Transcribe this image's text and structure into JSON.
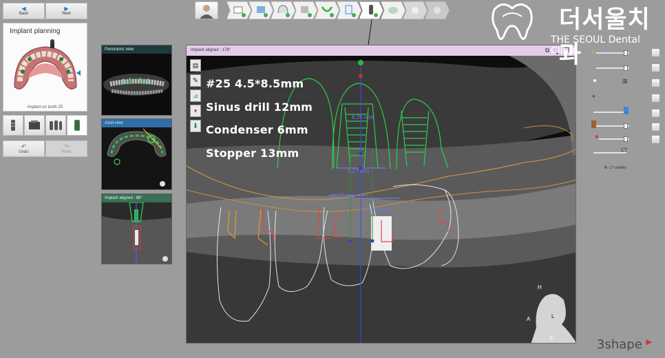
{
  "nav": {
    "back_label": "Back",
    "next_label": "Next"
  },
  "planning": {
    "title": "Implant planning",
    "subtitle": "Implant on tooth 25"
  },
  "undo": {
    "undo_label": "Undo",
    "redo_label": "Redo"
  },
  "views": {
    "panoramic_title": "Panoramic view",
    "axial_title": "Axial view",
    "implant_aligned_small_title": "Implant aligned : 88°"
  },
  "main_view": {
    "title": "Implant aligned : 178°",
    "overlay_lines": [
      "#25 4.5*8.5mm",
      "Sinus drill 12mm",
      "Condenser 6mm",
      "Stopper 13mm"
    ],
    "measurements": [
      "8.25 mm",
      "6.27 mm",
      "12.77 mm",
      "11.30 mm"
    ],
    "head_labels": {
      "h": "H",
      "a": "A",
      "l": "L",
      "f": "F"
    }
  },
  "right_panel": {
    "ct_visibility_label": "CT visibility"
  },
  "branding": {
    "logo_korean": "더서울치과",
    "logo_english": "THE SEOUL Dental Clinic",
    "vendor": "3shape"
  },
  "colors": {
    "accent_blue": "#2f6fa7",
    "implant_green": "#39d353",
    "measure_violet": "#6d74ff",
    "title_lilac": "#e2cde8"
  }
}
